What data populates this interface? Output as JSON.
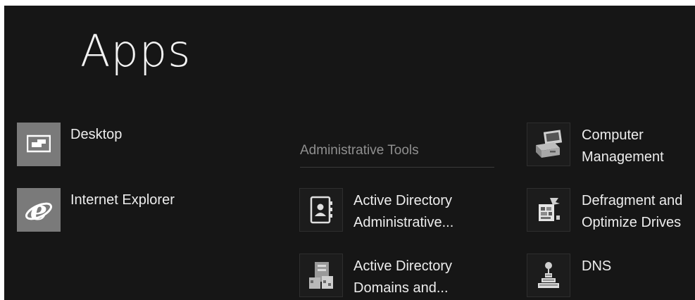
{
  "screen": {
    "title": "Apps"
  },
  "apps": [
    {
      "label": "Desktop",
      "icon": "desktop-icon"
    },
    {
      "label": "Internet Explorer",
      "icon": "internet-explorer-icon"
    }
  ],
  "admin_group": {
    "header": "Administrative Tools",
    "items": [
      {
        "line1": "Active Directory",
        "line2": "Administrative...",
        "icon": "address-book-icon"
      },
      {
        "line1": "Active Directory",
        "line2": "Domains and...",
        "icon": "domains-trusts-icon"
      }
    ]
  },
  "column3": [
    {
      "line1": "Computer",
      "line2": "Management",
      "icon": "computer-management-icon"
    },
    {
      "line1": "Defragment and",
      "line2": "Optimize Drives",
      "icon": "defragment-icon"
    },
    {
      "line1": "DNS",
      "icon": "dns-icon"
    }
  ],
  "colors": {
    "background": "#161616",
    "tile_gray": "#7a7a7a",
    "text": "#ededed",
    "group_header": "#8f8f8f"
  }
}
